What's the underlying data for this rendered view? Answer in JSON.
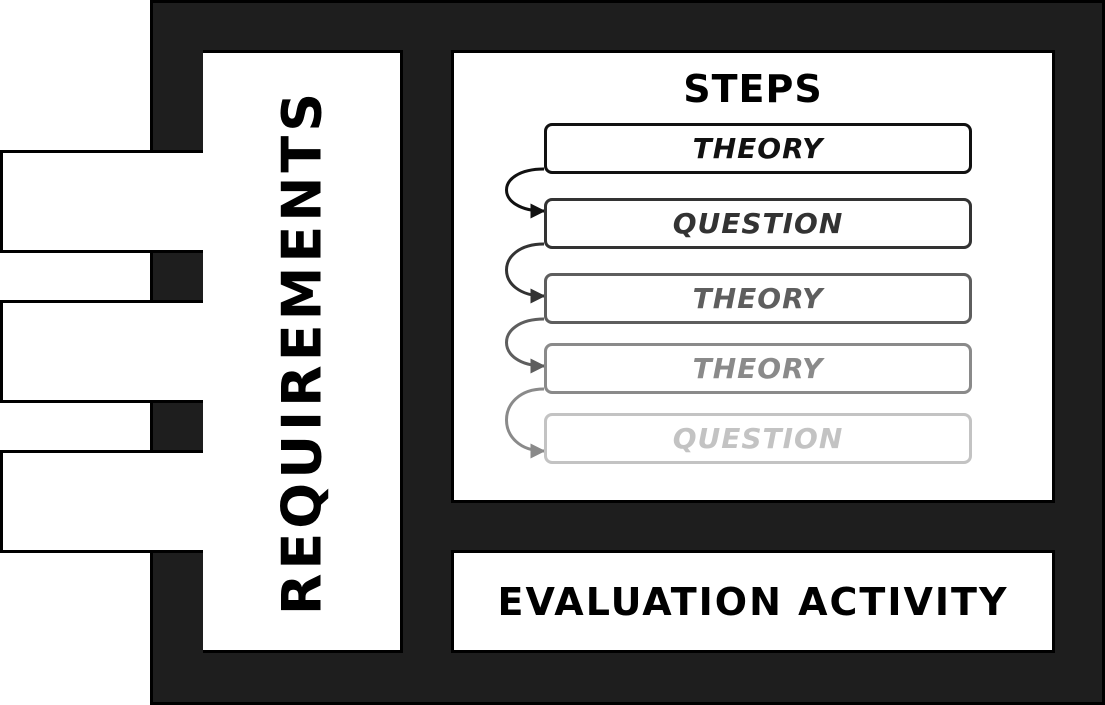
{
  "requirements": {
    "label": "REQUIREMENTS"
  },
  "steps": {
    "title": "STEPS",
    "items": [
      {
        "label": "THEORY",
        "color": "#111111"
      },
      {
        "label": "QUESTION",
        "color": "#333333"
      },
      {
        "label": "THEORY",
        "color": "#5e5e5e"
      },
      {
        "label": "THEORY",
        "color": "#8a8a8a"
      },
      {
        "label": "QUESTION",
        "color": "#c3c3c3"
      }
    ]
  },
  "evaluation": {
    "label": "EVALUATION ACTIVITY"
  }
}
